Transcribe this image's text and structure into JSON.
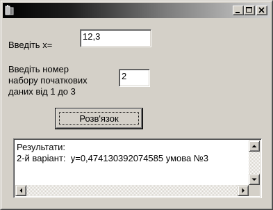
{
  "window": {
    "title": "",
    "icons": {
      "app": "app-icon",
      "minimize": "minimize-icon",
      "maximize": "maximize-icon",
      "close": "close-icon"
    }
  },
  "form": {
    "x_label": "Введіть x=",
    "x_value": "12,3",
    "set_label_line1": "Введіть номер",
    "set_label_line2": "набору початкових",
    "set_label_line3": "даних від 1 до 3",
    "set_value": "2",
    "solve_button": "Розв'язок"
  },
  "results": {
    "line1": "Результати:",
    "line2": "2-й варіант:  y=0,474130392074585 умова №3"
  }
}
